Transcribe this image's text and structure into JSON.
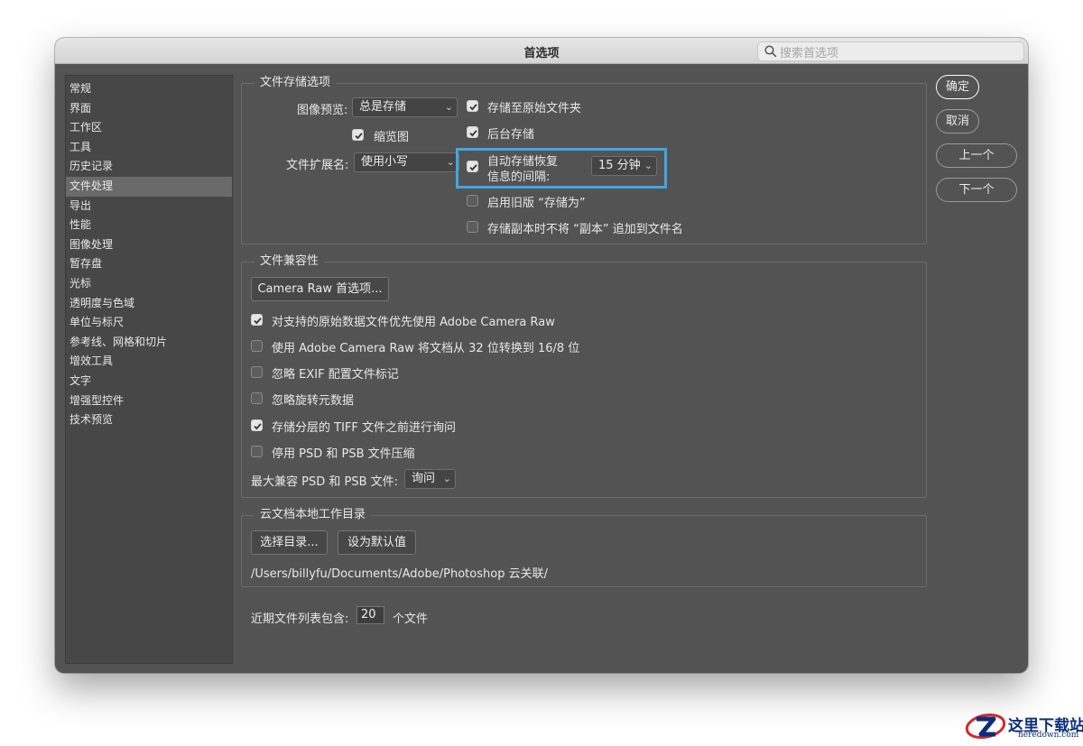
{
  "window": {
    "title": "首选项"
  },
  "search": {
    "placeholder": "搜索首选项"
  },
  "sidebar": {
    "items": [
      {
        "label": "常规"
      },
      {
        "label": "界面"
      },
      {
        "label": "工作区"
      },
      {
        "label": "工具"
      },
      {
        "label": "历史记录"
      },
      {
        "label": "文件处理"
      },
      {
        "label": "导出"
      },
      {
        "label": "性能"
      },
      {
        "label": "图像处理"
      },
      {
        "label": "暂存盘"
      },
      {
        "label": "光标"
      },
      {
        "label": "透明度与色域"
      },
      {
        "label": "单位与标尺"
      },
      {
        "label": "参考线、网格和切片"
      },
      {
        "label": "增效工具"
      },
      {
        "label": "文字"
      },
      {
        "label": "增强型控件"
      },
      {
        "label": "技术预览"
      }
    ],
    "active": "文件处理"
  },
  "file_saving": {
    "title": "文件存储选项",
    "image_preview_label": "图像预览:",
    "image_preview_value": "总是存储",
    "thumbnail_label": "缩览图",
    "extension_label": "文件扩展名:",
    "extension_value": "使用小写",
    "save_to_original_label": "存储至原始文件夹",
    "background_save_label": "后台存储",
    "autosave_line1": "自动存储恢复",
    "autosave_line2": "信息的间隔:",
    "autosave_interval": "15 分钟",
    "legacy_save_as_label": "启用旧版 “存储为”",
    "no_copy_suffix_label": "存储副本时不将 “副本” 追加到文件名"
  },
  "compatibility": {
    "title": "文件兼容性",
    "camera_raw_button": "Camera Raw 首选项...",
    "prefer_acr_label": "对支持的原始数据文件优先使用 Adobe Camera Raw",
    "convert_32_label": "使用 Adobe Camera Raw 将文档从 32 位转换到 16/8 位",
    "ignore_exif_label": "忽略 EXIF 配置文件标记",
    "ignore_rotation_label": "忽略旋转元数据",
    "ask_tiff_label": "存储分层的 TIFF 文件之前进行询问",
    "disable_psd_compression_label": "停用 PSD 和 PSB 文件压缩",
    "maximize_label": "最大兼容 PSD 和 PSB 文件:",
    "maximize_value": "询问"
  },
  "cloud": {
    "title": "云文档本地工作目录",
    "choose_button": "选择目录...",
    "default_button": "设为默认值",
    "path": "/Users/billyfu/Documents/Adobe/Photoshop 云关联/"
  },
  "recent": {
    "prefix": "近期文件列表包含:",
    "value": "20",
    "suffix": "个文件"
  },
  "buttons": {
    "ok": "确定",
    "cancel": "取消",
    "prev": "上一个",
    "next": "下一个"
  },
  "watermark": {
    "name": "这里下载站",
    "domain": "heredown.com"
  },
  "colors": {
    "highlight": "#3da7e6",
    "panel": "#535353",
    "titlebar": "#e0e0e0"
  }
}
